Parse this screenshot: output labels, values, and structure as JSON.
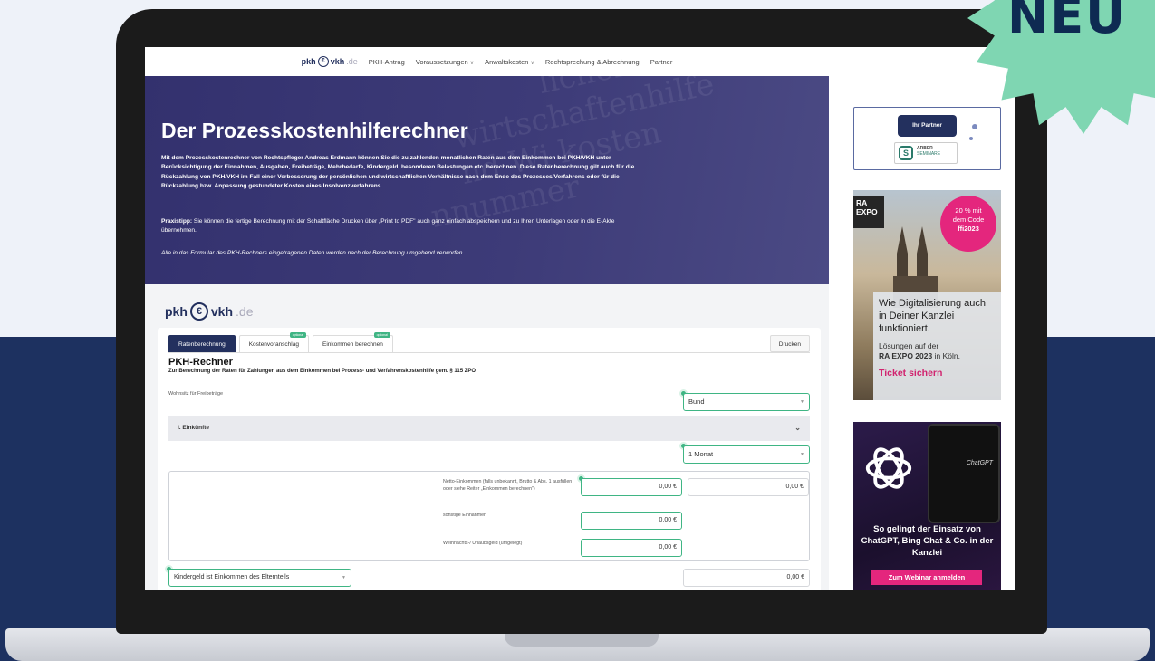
{
  "badge": {
    "text": "NEU",
    "color": "#7fd6b2"
  },
  "nav": {
    "logo": {
      "pkh": "pkh",
      "vkh": "vkh",
      "de": ".de"
    },
    "items": [
      {
        "label": "PKH-Antrag",
        "dropdown": false
      },
      {
        "label": "Voraussetzungen",
        "dropdown": true
      },
      {
        "label": "Anwaltskosten",
        "dropdown": true
      },
      {
        "label": "Rechtsprechung & Abrechnung",
        "dropdown": false
      },
      {
        "label": "Partner",
        "dropdown": false
      }
    ]
  },
  "hero": {
    "title": "Der Prozesskostenhilferechner",
    "paragraph": "Mit dem Prozesskostenrechner von Rechtspfleger Andreas Erdmann können Sie die zu zahlenden monatlichen Raten aus dem Einkommen bei PKH/VKH unter Berücksichtigung der Einnahmen, Ausgaben, Freibeträge, Mehrbedarfe, Kindergeld, besonderen Belastungen etc. berechnen. Diese Ratenberechnung gilt auch für die Rückzahlung von PKH/VKH im Fall einer Verbesserung der persönlichen und wirtschaftlichen Verhältnisse nach dem Ende des Prozesses/Verfahrens oder für die Rückzahlung bzw. Anpassung gestundeter Kosten eines Insolvenzverfahrens.",
    "tip_label": "Praxistipp:",
    "tip": "Sie können die fertige Berechnung mit der Schaltfläche Drucken über „Print to PDF\" auch ganz einfach abspeichern und zu Ihren Unterlagen oder in die E-Akte übernehmen.",
    "note": "Alle in das Formular des PKH-Rechners eingetragenen Daten werden nach der Berechnung umgehend verworfen."
  },
  "calc": {
    "logo": {
      "pkh": "pkh",
      "vkh": "vkh",
      "de": ".de"
    },
    "tabs": [
      {
        "label": "Ratenberechnung",
        "active": true,
        "badge": ""
      },
      {
        "label": "Kostenvoranschlag",
        "active": false,
        "badge": "optional"
      },
      {
        "label": "Einkommen berechnen",
        "active": false,
        "badge": "optional"
      }
    ],
    "print_label": "Drucken",
    "title": "PKH-Rechner",
    "subtitle": "Zur Berechnung der Raten für Zahlungen aus dem Einkommen bei Prozess- und Verfahrenskostenhilfe gem. § 115 ZPO",
    "wohnsitz_label": "Wohnsitz für Freibeträge",
    "wohnsitz_value": "Bund",
    "section_label": "I. Einkünfte",
    "period_value": "1 Monat",
    "fields": [
      {
        "label": "Netto-Einkommen (falls unbekannt, Brutto & Abs. 1 ausfüllen oder siehe Reiter „Einkommen berechnen\")",
        "value": "0,00 €",
        "value2": "0,00 €"
      },
      {
        "label": "sonstige Einnahmen",
        "value": "0,00 €"
      },
      {
        "label": "Weihnachts-/ Urlaubsgeld (umgelegt)",
        "value": "0,00 €"
      }
    ],
    "kindergeld_label": "Kindergeld ist Einkommen des Elternteils",
    "kindergeld_value": "0,00 €"
  },
  "sidebar": {
    "partner": {
      "pill": "Ihr Partner",
      "logo_name": "ARBER",
      "logo_sub": "SEMINARE"
    },
    "ad_raexpo": {
      "brand_top": "RA",
      "brand_bottom": "EXPO",
      "promo_line1": "20 % mit",
      "promo_line2": "dem Code",
      "promo_code": "ffi2023",
      "headline": "Wie Digitalisierung auch in Deiner Kanzlei funktioniert.",
      "sub1": "Lösungen auf der",
      "sub2_bold": "RA EXPO 2023",
      "sub2_rest": " in Köln.",
      "link": "Ticket sichern"
    },
    "ad_gpt": {
      "phone_title": "ChatGPT",
      "headline": "So gelingt der Einsatz von ChatGPT, Bing Chat & Co. in der Kanzlei",
      "button": "Zum Webinar anmelden"
    }
  }
}
